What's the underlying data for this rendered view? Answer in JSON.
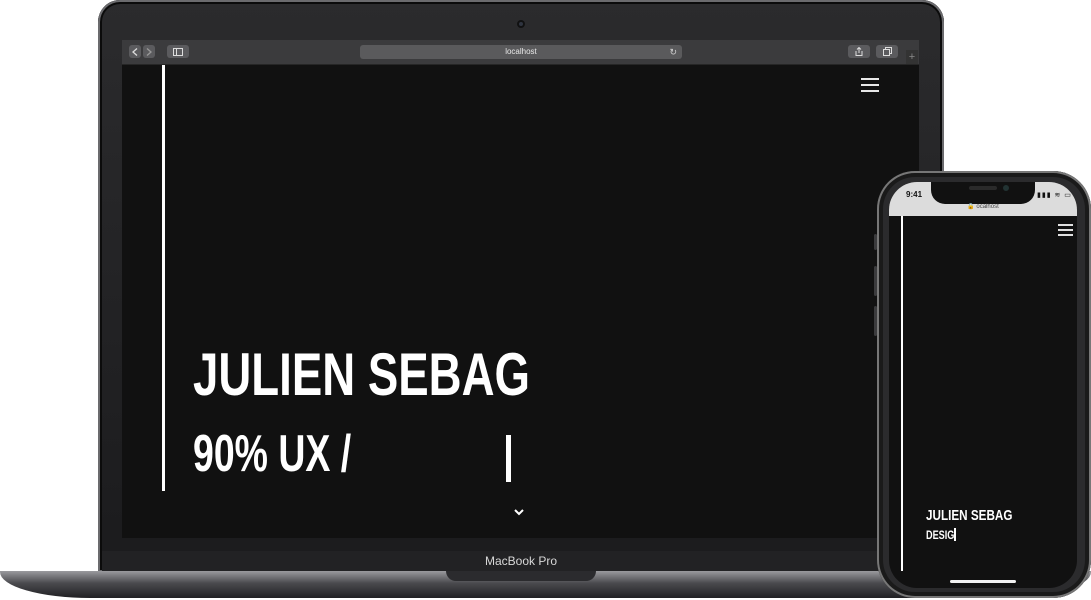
{
  "laptop": {
    "model_label": "MacBook Pro",
    "browser": {
      "url": "localhost",
      "back_icon": "chevron-left-icon",
      "forward_icon": "chevron-right-icon",
      "sidebar_icon": "sidebar-icon",
      "reload_icon": "reload-icon",
      "share_icon": "share-icon",
      "tabs_icon": "tabs-icon",
      "new_tab_label": "+"
    },
    "site": {
      "name": "JULIEN SEBAG",
      "typed_text": "90% UX /",
      "menu_icon": "hamburger-icon",
      "scroll_icon": "chevron-down-icon",
      "background": "#111111",
      "text_color": "#ffffff"
    }
  },
  "phone": {
    "status": {
      "time": "9:41",
      "signal": "▮▮▮ ≋ ▭"
    },
    "url": "🔒 ocalhost",
    "site": {
      "name": "JULIEN SEBAG",
      "typed_text": "DESIG",
      "menu_icon": "hamburger-icon"
    }
  }
}
